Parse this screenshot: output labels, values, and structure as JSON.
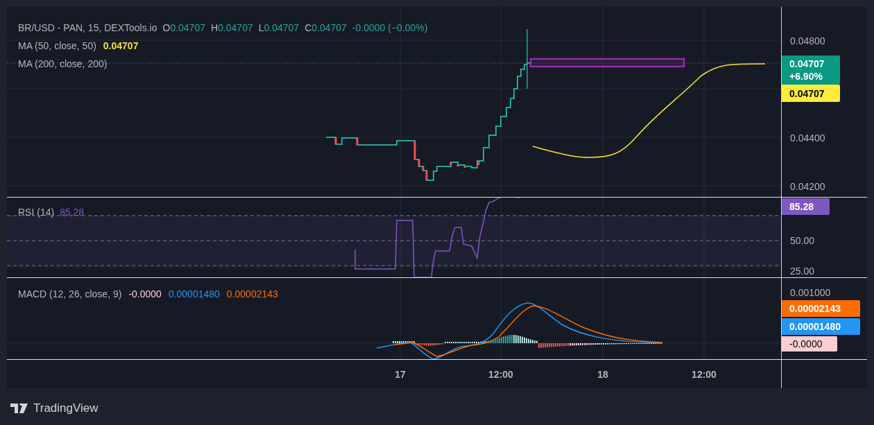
{
  "legend": {
    "title": "BR/USD - PAN, 15, DEXTools.io",
    "ohlc": [
      {
        "label": "O",
        "value": "0.04707"
      },
      {
        "label": "H",
        "value": "0.04707"
      },
      {
        "label": "L",
        "value": "0.04707"
      },
      {
        "label": "C",
        "value": "0.04707"
      }
    ],
    "change": "-0.0000 (−0.00%)",
    "indicators": [
      {
        "label": "MA (50, close, 50)",
        "value": "0.04707"
      },
      {
        "label": "MA (200, close, 200)"
      }
    ]
  },
  "price_axis": {
    "labels": [
      "0.04800",
      "0.04400",
      "0.04200"
    ],
    "badges": [
      {
        "kind": "last",
        "price": "0.04707",
        "change": "+6.90%"
      },
      {
        "kind": "ma",
        "price": "0.04707"
      }
    ]
  },
  "rsi": {
    "label": "RSI (14)",
    "value": "85.28",
    "axis_labels": [
      "50.00",
      "25.00"
    ],
    "badge": "85.28"
  },
  "macd": {
    "label": "MACD (12, 26, close, 9)",
    "values": [
      {
        "kind": "histogram",
        "value": "-0.0000"
      },
      {
        "kind": "macd",
        "value": "0.00001480"
      },
      {
        "kind": "signal",
        "value": "0.00002143"
      }
    ],
    "axis_label": "0.001000",
    "badges": [
      {
        "kind": "signal",
        "value": "0.00002143"
      },
      {
        "kind": "macd",
        "value": "0.00001480"
      },
      {
        "kind": "histogram",
        "value": "-0.0000"
      }
    ]
  },
  "time_axis": [
    "17",
    "12:00",
    "18",
    "12:00"
  ],
  "brand": "TradingView"
}
